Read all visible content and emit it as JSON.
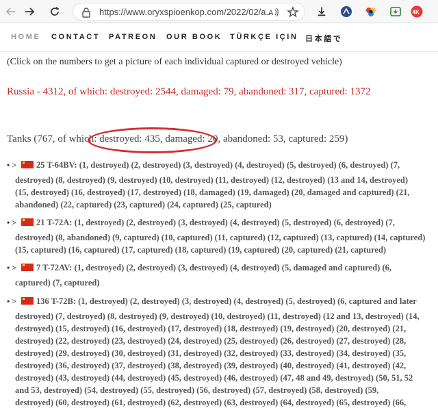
{
  "browser": {
    "url": "https://www.oryxspioenkop.com/2022/02/a...",
    "icons": [
      "back-icon",
      "forward-icon",
      "refresh-icon",
      "lock-icon",
      "read-aloud-icon",
      "favorite-star-icon",
      "download-icon",
      "extension-icon",
      "extension-icon",
      "extension-icon",
      "extension-icon"
    ]
  },
  "nav": {
    "items": [
      "HOME",
      "CONTACT",
      "PATREON",
      "OUR BOOK",
      "TÜRKÇE IÇIN",
      "日本語で"
    ]
  },
  "content": {
    "click_note": "(Click on the numbers to get a picture of each individual captured or destroyed vehicle)",
    "russia_summary": "Russia - 4312, of which: destroyed: 2544, damaged: 79, abandoned: 317, captured: 1372",
    "tanks_summary": "Tanks (767, of which: destroyed: 435, damaged: 20, abandoned: 53, captured: 259)",
    "annotation_color": "#d32f2f",
    "entries": [
      {
        "first": "25 T-64BV: (1, destroyed) (2, destroyed) (3, destroyed) (4, destroyed) (5, destroyed) (6, destroyed) (7,",
        "lines": [
          "destroyed) (8, destroyed) (9, destroyed) (10, destroyed) (11, destroyed) (12, destroyed) (13 and 14, destroyed)",
          "(15, destroyed) (16, destroyed) (17, destroyed) (18, damaged) (19, damaged) (20, damaged and captured) (21,",
          "abandoned) (22, captured) (23, captured) (24, captured) (25, captured)"
        ]
      },
      {
        "first": "21 T-72A: (1, destroyed) (2, destroyed) (3, destroyed) (4, destroyed) (5, destroyed) (6, destroyed) (7,",
        "lines": [
          "destroyed) (8, abandoned) (9, captured) (10, captured) (11, captured) (12, captured) (13, captured) (14, captured)",
          "(15, captured) (16, captured) (17, captured) (18, captured) (19, captured) (20, captured) (21, captured)"
        ]
      },
      {
        "first": "7 T-72AV: (1, destroyed) (2, destroyed) (3, destroyed) (4, destroyed) (5, damaged and captured) (6,",
        "lines": [
          "captured) (7, captured)"
        ]
      },
      {
        "first": "136 T-72B: (1, destroyed) (2, destroyed) (3, destroyed) (4, destroyed) (5, destroyed) (6, captured and later",
        "lines": [
          "destroyed) (7, destroyed) (8, destroyed) (9, destroyed) (10, destroyed) (11, destroyed) (12 and 13, destroyed) (14,",
          "destroyed) (15, destroyed) (16, destroyed) (17, destroyed) (18, destroyed) (19, destroyed) (20, destroyed) (21,",
          "destroyed) (22, destroyed) (23, destroyed) (24, destroyed) (25, destroyed) (26, destroyed) (27, destroyed) (28,",
          "destroyed) (29, destroyed) (30, destroyed) (31, destroyed) (32, destroyed) (33, destroyed) (34, destroyed) (35,",
          "destroyed) (36, destroyed) (37, destroyed) (38, destroyed) (39, destroyed) (40, destroyed) (41, destroyed) (42,",
          "destroyed) (43, destroyed) (44, destroyed) (45, destroyed) (46, destroyed) (47, 48 and 49, destroyed) (50, 51, 52",
          "and 53, destroyed) (54, destroyed) (55, destroyed) (56, destroyed) (57, destroyed) (58, destroyed) (59,",
          "destroyed) (60, destroyed) (61, destroyed) (62, destroyed) (63, destroyed) (64, destroyed) (65, destroyed) (66,"
        ]
      }
    ]
  }
}
